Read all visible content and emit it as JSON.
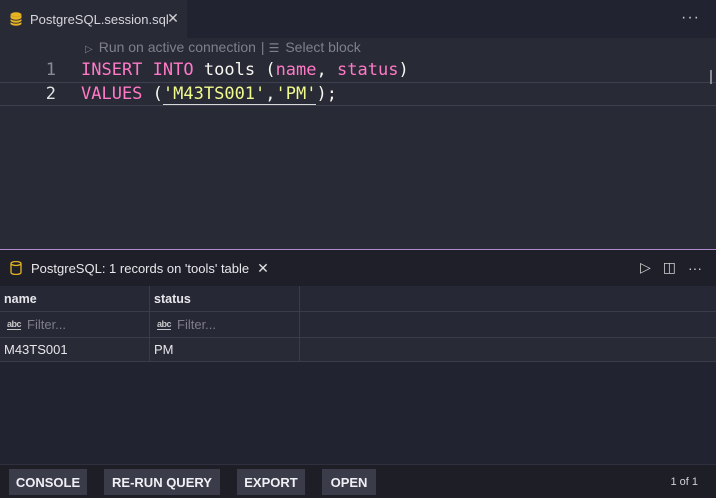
{
  "editor_tab": {
    "title": "PostgreSQL.session.sql",
    "close": "✕",
    "icon": "database-icon"
  },
  "tabbar": {
    "more": "···"
  },
  "codelens": {
    "run": "Run on active connection",
    "separator": "|",
    "select": "Select block"
  },
  "code": {
    "line1": {
      "number": "1",
      "tokens": [
        "INSERT",
        "INTO",
        "tools",
        "(",
        "name",
        ",",
        "status",
        ")"
      ]
    },
    "line2": {
      "number": "2",
      "tokens": [
        "VALUES",
        "(",
        "'M43TS001'",
        ",",
        "'PM'",
        ");"
      ]
    }
  },
  "panel": {
    "title": "PostgreSQL: 1 records on 'tools' table",
    "close": "✕",
    "actions": {
      "run": "▷",
      "split": "◫",
      "more": "···"
    }
  },
  "grid": {
    "columns": [
      "name",
      "status"
    ],
    "filter_placeholder": "Filter...",
    "rows": [
      [
        "M43TS001",
        "PM"
      ]
    ]
  },
  "bottom": {
    "buttons": [
      "CONSOLE",
      "RE-RUN QUERY",
      "EXPORT",
      "OPEN"
    ],
    "pager": "1 of 1"
  },
  "colors": {
    "keyword": "#ff79c6",
    "string": "#f1fa8c",
    "background": "#282a36",
    "panel_border": "#b08bd0"
  }
}
